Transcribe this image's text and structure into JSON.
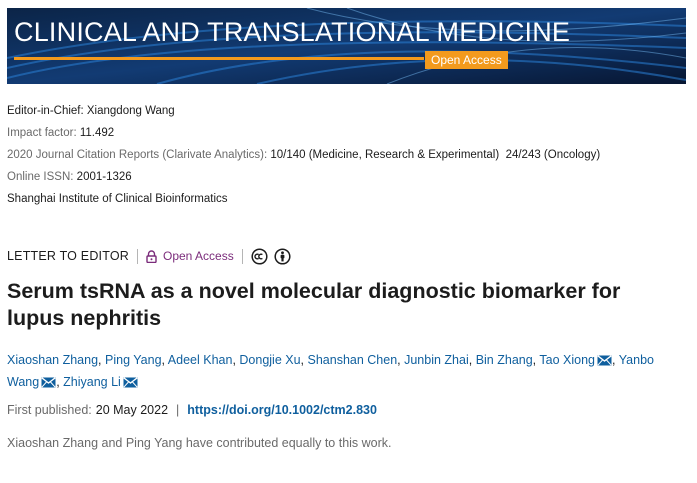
{
  "banner": {
    "journal_title": "CLINICAL AND TRANSLATIONAL MEDICINE",
    "badge": "Open Access"
  },
  "meta": {
    "editor_label": "Editor-in-Chief: Xiangdong Wang",
    "impact_label": "Impact factor: ",
    "impact_value": "11.492",
    "jcr_label": "2020 Journal Citation Reports (Clarivate Analytics): ",
    "jcr_value": "10/140 (Medicine, Research & Experimental)  24/243 (Oncology)",
    "issn_label": "Online ISSN: ",
    "issn_value": "2001-1326",
    "publisher": "Shanghai Institute of Clinical Bioinformatics"
  },
  "article": {
    "type": "LETTER TO EDITOR",
    "access": "Open Access",
    "title": "Serum tsRNA as a novel molecular diagnostic biomarker for lupus nephritis",
    "authors": [
      {
        "name": "Xiaoshan Zhang",
        "mail": false
      },
      {
        "name": "Ping Yang",
        "mail": false
      },
      {
        "name": "Adeel Khan",
        "mail": false
      },
      {
        "name": "Dongjie Xu",
        "mail": false
      },
      {
        "name": "Shanshan Chen",
        "mail": false
      },
      {
        "name": "Junbin Zhai",
        "mail": false
      },
      {
        "name": "Bin Zhang",
        "mail": false
      },
      {
        "name": "Tao Xiong",
        "mail": true
      },
      {
        "name": "Yanbo Wang",
        "mail": true
      },
      {
        "name": "Zhiyang Li",
        "mail": true
      }
    ],
    "published_label": "First published:",
    "published_date": "20 May 2022",
    "separator": "|",
    "doi": "https://doi.org/10.1002/ctm2.830",
    "note": "Xiaoshan Zhang and Ping Yang have contributed equally to this work."
  },
  "icons": {
    "lock": "lock-icon",
    "cc": "creative-commons-icon",
    "by": "attribution-icon",
    "mail": "envelope-icon"
  },
  "colors": {
    "banner_bg": "#0a1f3a",
    "accent_orange": "#f39a1d",
    "link_blue": "#0f5f9e",
    "open_access_purple": "#7b2c7b"
  }
}
